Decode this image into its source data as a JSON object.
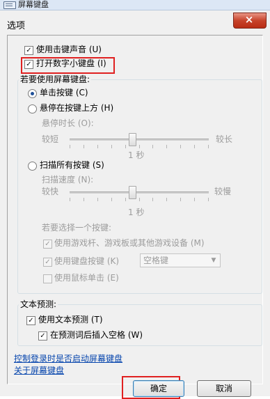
{
  "parent_window": {
    "title": "屏幕键盘"
  },
  "dialog": {
    "title": "选项",
    "close_glyph": "×"
  },
  "options": {
    "key_sound": {
      "label": "使用击键声音 (U)",
      "checked": true
    },
    "numeric_keypad": {
      "label": "打开数字小键盘 (I)",
      "checked": true
    }
  },
  "screen_keyboard_group": {
    "caption": "若要使用屏幕键盘:",
    "click_keys": {
      "label": "单击按键 (C)",
      "selected": true
    },
    "hover_keys": {
      "label": "悬停在按键上方 (H)",
      "selected": false,
      "duration_label": "悬停时长 (O):",
      "min_label": "较短",
      "max_label": "较长",
      "value_text": "1 秒",
      "level": 0.45
    },
    "scan_keys": {
      "label": "扫描所有按键 (S)",
      "selected": false,
      "speed_label": "扫描速度 (N):",
      "min_label": "较快",
      "max_label": "较慢",
      "value_text": "1 秒",
      "level": 0.45
    },
    "select_key_caption": "若要选择一个按键:",
    "use_gamepad": {
      "label": "使用游戏杆、游戏板或其他游戏设备 (M)",
      "checked": true
    },
    "use_keyboard_key": {
      "label": "使用键盘按键 (K)",
      "checked": true,
      "combo_value": "空格键"
    },
    "use_mouse_click": {
      "label": "使用鼠标单击 (E)",
      "checked": false
    }
  },
  "text_prediction_group": {
    "caption": "文本预测:",
    "use_prediction": {
      "label": "使用文本预测 (T)",
      "checked": true
    },
    "insert_space": {
      "label": "在预测词后插入空格 (W)",
      "checked": true
    }
  },
  "links": {
    "logon_control": "控制登录时是否启动屏幕键盘",
    "about": "关于屏幕键盘"
  },
  "buttons": {
    "ok": "确定",
    "cancel": "取消"
  },
  "colors": {
    "highlight_red": "#e02020",
    "link_blue": "#0645ad"
  }
}
